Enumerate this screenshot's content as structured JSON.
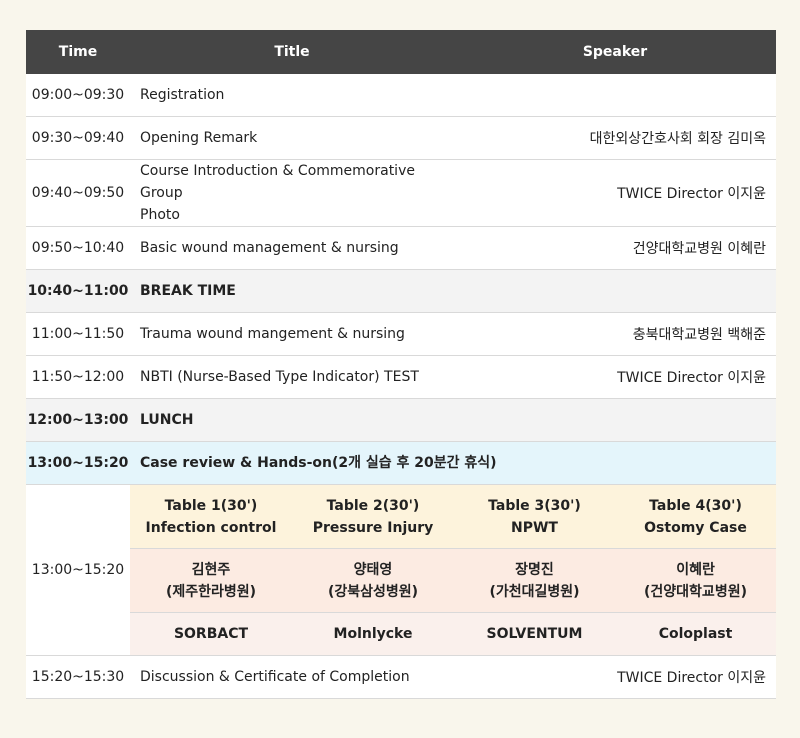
{
  "header": {
    "time": "Time",
    "title": "Title",
    "speaker": "Speaker"
  },
  "rows": [
    {
      "time": "09:00~09:30",
      "title": "Registration",
      "speaker": ""
    },
    {
      "time": "09:30~09:40",
      "title": "Opening Remark",
      "speaker": "대한외상간호사회 회장 김미옥"
    },
    {
      "time": "09:40~09:50",
      "title_line1": "Course Introduction & Commemorative Group",
      "title_line2": "Photo",
      "speaker": "TWICE Director 이지윤"
    },
    {
      "time": "09:50~10:40",
      "title": "Basic wound management & nursing",
      "speaker": "건양대학교병원 이혜란"
    },
    {
      "time": "10:40~11:00",
      "title": "BREAK TIME",
      "speaker": ""
    },
    {
      "time": "11:00~11:50",
      "title": "Trauma wound mangement & nursing",
      "speaker": "충북대학교병원 백해준"
    },
    {
      "time": "11:50~12:00",
      "title": "NBTI (Nurse-Based Type Indicator) TEST",
      "speaker": "TWICE Director 이지윤"
    },
    {
      "time": "12:00~13:00",
      "title": "LUNCH",
      "speaker": ""
    },
    {
      "time": "13:00~15:20",
      "title": "Case review & Hands-on(2개 실습 후 20분간 휴식)",
      "speaker": ""
    },
    {
      "time": "15:20~15:30",
      "title": "Discussion & Certificate of Completion",
      "speaker": "TWICE Director 이지윤"
    }
  ],
  "handson": {
    "time": "13:00~15:20",
    "tables": [
      {
        "name": "Table 1(30')",
        "topic": "Infection control",
        "lead": "김현주",
        "hospital": "(제주한라병원)",
        "sponsor": "SORBACT"
      },
      {
        "name": "Table 2(30')",
        "topic": "Pressure Injury",
        "lead": "양태영",
        "hospital": "(강북삼성병원)",
        "sponsor": "Molnlycke"
      },
      {
        "name": "Table 3(30')",
        "topic": "NPWT",
        "lead": "장명진",
        "hospital": "(가천대길병원)",
        "sponsor": "SOLVENTUM"
      },
      {
        "name": "Table 4(30')",
        "topic": "Ostomy Case",
        "lead": "이혜란",
        "hospital": "(건양대학교병원)",
        "sponsor": "Coloplast"
      }
    ]
  }
}
